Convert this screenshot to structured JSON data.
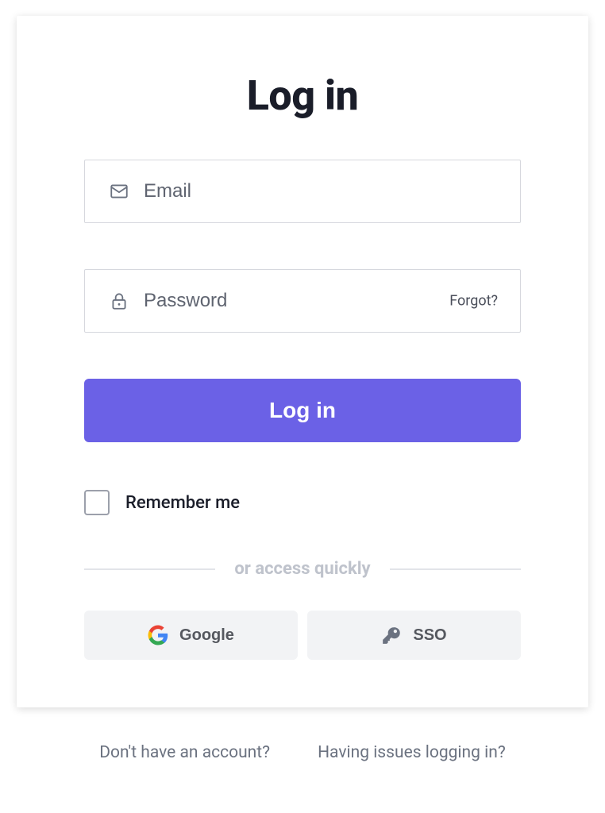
{
  "title": "Log in",
  "email": {
    "placeholder": "Email",
    "value": ""
  },
  "password": {
    "placeholder": "Password",
    "value": "",
    "forgot_label": "Forgot?"
  },
  "login_button": "Log in",
  "remember_label": "Remember me",
  "divider_text": "or access quickly",
  "social": {
    "google": "Google",
    "sso": "SSO"
  },
  "footer": {
    "no_account": "Don't have an account?",
    "issues": "Having issues logging in?"
  },
  "colors": {
    "primary": "#6b61e6",
    "text_dark": "#1a1d29",
    "text_muted": "#6b7280"
  }
}
